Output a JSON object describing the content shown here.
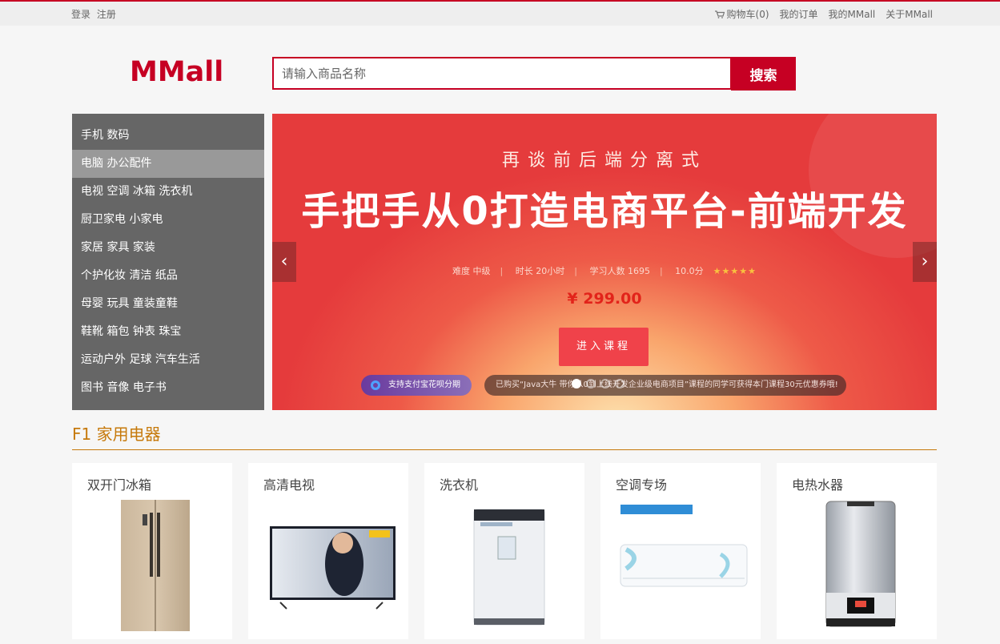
{
  "topbar": {
    "login": "登录",
    "register": "注册",
    "cart": "购物车(0)",
    "orders": "我的订单",
    "my_mall": "我的MMall",
    "about": "关于MMall"
  },
  "header": {
    "logo": "MMall",
    "search_placeholder": "请输入商品名称",
    "search_button": "搜索"
  },
  "categories": [
    {
      "label": "手机  数码"
    },
    {
      "label": "电脑  办公配件"
    },
    {
      "label": "电视  空调  冰箱  洗衣机"
    },
    {
      "label": "厨卫家电  小家电"
    },
    {
      "label": "家居  家具  家装"
    },
    {
      "label": "个护化妆  清洁  纸品"
    },
    {
      "label": "母婴  玩具  童装童鞋"
    },
    {
      "label": "鞋靴  箱包  钟表  珠宝"
    },
    {
      "label": "运动户外  足球  汽车生活"
    },
    {
      "label": "图书  音像  电子书"
    }
  ],
  "banner": {
    "subtitle": "再谈前后端分离式",
    "title": "手把手从0打造电商平台-前端开发",
    "difficulty": "难度  中级",
    "duration": "时长  20小时",
    "learners": "学习人数  1695",
    "score": "10.0分",
    "stars": "★★★★★",
    "price": "¥ 299.00",
    "enter": "进入课程",
    "alipay": "支持支付宝花呗分期",
    "notice": "已购买“Java大牛 带你从0到上线开发企业级电商项目”课程的同学可获得本门课程30元优惠券哦!",
    "prev_arrow": "‹",
    "next_arrow": "›"
  },
  "floor": {
    "title": "F1 家用电器",
    "products": [
      {
        "name": "双开门冰箱"
      },
      {
        "name": "高清电视"
      },
      {
        "name": "洗衣机"
      },
      {
        "name": "空调专场"
      },
      {
        "name": "电热水器"
      }
    ]
  },
  "colors": {
    "brand": "#c60023",
    "nav_bg": "#666666",
    "nav_active": "#999999",
    "floor_accent": "#c6790b"
  }
}
